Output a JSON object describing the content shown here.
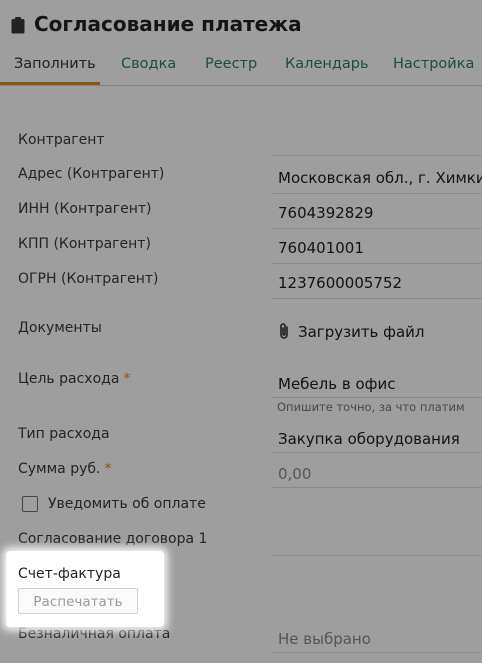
{
  "title": "Согласование платежа",
  "tabs": [
    {
      "label": "Заполнить"
    },
    {
      "label": "Сводка"
    },
    {
      "label": "Реестр"
    },
    {
      "label": "Календарь"
    },
    {
      "label": "Настройка"
    }
  ],
  "form": {
    "counterparty": {
      "label": "Контрагент",
      "value": ""
    },
    "address": {
      "label": "Адрес (Контрагент)",
      "value": "Московская обл., г. Химки, ул"
    },
    "inn": {
      "label": "ИНН (Контрагент)",
      "value": "7604392829"
    },
    "kpp": {
      "label": "КПП (Контрагент)",
      "value": "760401001"
    },
    "ogrn": {
      "label": "ОГРН (Контрагент)",
      "value": "1237600005752"
    },
    "documents": {
      "label": "Документы",
      "upload_label": "Загрузить файл"
    },
    "purpose": {
      "label": "Цель расхода",
      "required_mark": "*",
      "value": "Мебель в офис",
      "hint": "Опишите точно, за что платим"
    },
    "expense_type": {
      "label": "Тип расхода",
      "value": "Закупка оборудования"
    },
    "amount": {
      "label": "Сумма руб.",
      "required_mark": "*",
      "placeholder": "0,00"
    },
    "notify": {
      "label": "Уведомить об оплате",
      "checked": false
    },
    "contract_approval": {
      "label": "Согласование договора 1",
      "value": ""
    },
    "invoice": {
      "label": "Счет-фактура",
      "button_label": "Распечатать"
    },
    "cashless": {
      "label": "Безналичная оплата",
      "placeholder": "Не выбрано"
    }
  },
  "colors": {
    "accent": "#e08a1e",
    "tab_link": "#2e7a70",
    "overlay": "rgba(0,0,0,0.38)"
  }
}
